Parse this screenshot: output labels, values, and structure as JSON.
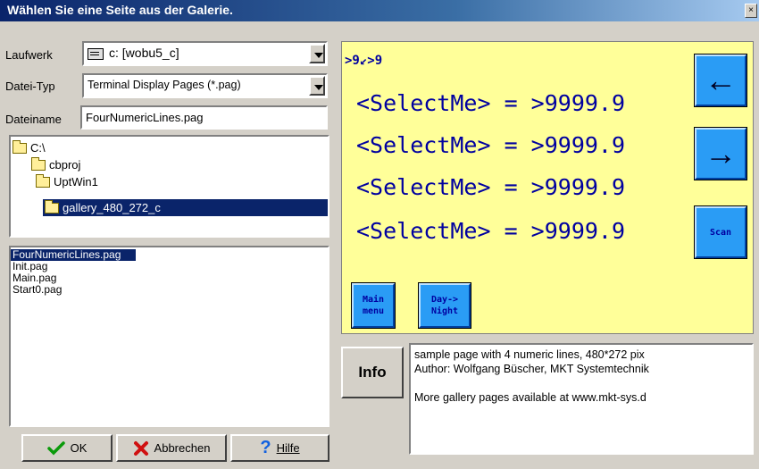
{
  "window": {
    "title": "Wählen Sie eine Seite aus der Galerie.",
    "close_glyph": "×"
  },
  "laufwerk": {
    "label": "Laufwerk",
    "value": "c: [wobu5_c]",
    "icon": "drive-icon"
  },
  "dateityp": {
    "label": "Datei-Typ",
    "value": "Terminal Display Pages  (*.pag)"
  },
  "dateiname": {
    "label": "Dateiname",
    "value": "FourNumericLines.pag"
  },
  "directories": [
    {
      "label": "C:\\",
      "selected": false
    },
    {
      "label": "cbproj",
      "selected": false
    },
    {
      "label": "UptWin1",
      "selected": false
    },
    {
      "label": "gallery_480_272_c",
      "selected": true
    }
  ],
  "files": [
    {
      "label": "FourNumericLines.pag",
      "selected": true
    },
    {
      "label": "Init.pag",
      "selected": false
    },
    {
      "label": "Main.pag",
      "selected": false
    },
    {
      "label": "Start0.pag",
      "selected": false
    }
  ],
  "buttons": {
    "ok": "OK",
    "cancel": "Abbrechen",
    "help": "Hilfe"
  },
  "preview": {
    "header": ">9↙>9",
    "lines": [
      "<SelectMe> = >9999.9",
      "<SelectMe> = >9999.9",
      "<SelectMe> = >9999.9",
      "<SelectMe> = >9999.9"
    ],
    "nav_left_glyph": "←",
    "nav_right_glyph": "→",
    "scan_label": "Scan",
    "main_menu_label": "Main\nmenu",
    "day_night_label": "Day->\nNight",
    "background_color": "#ffff99",
    "text_color": "#0000a0",
    "button_color": "#2a9cf5"
  },
  "info": {
    "button_label": "Info",
    "text": "sample page with 4 numeric lines, 480*272 pix\nAuthor: Wolfgang Büscher, MKT Systemtechnik\n\nMore gallery pages available at www.mkt-sys.d"
  }
}
